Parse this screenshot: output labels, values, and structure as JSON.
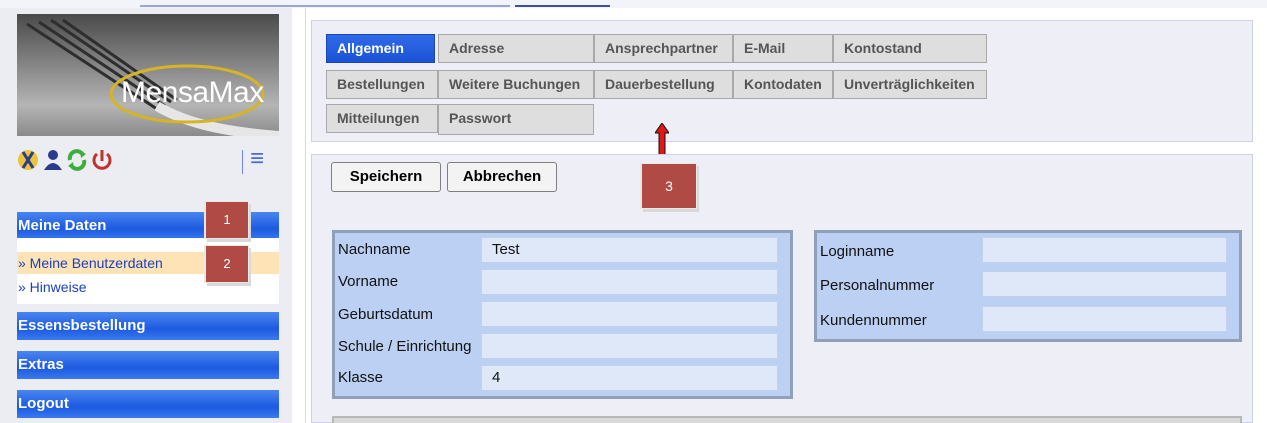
{
  "app": {
    "logo_text": "MensaMax"
  },
  "toolbar": {
    "icons": [
      "cutlery-icon",
      "user-icon",
      "refresh-icon",
      "power-icon",
      "menu-icon"
    ]
  },
  "sidebar": {
    "sections": [
      {
        "label": "Meine Daten"
      },
      {
        "label": "Essensbestellung"
      },
      {
        "label": "Extras"
      },
      {
        "label": "Logout"
      }
    ],
    "subitems": [
      {
        "label": "» Meine Benutzerdaten",
        "active": true
      },
      {
        "label": "» Hinweise",
        "active": false
      }
    ]
  },
  "annotations": {
    "m1": "1",
    "m2": "2",
    "m3": "3"
  },
  "tabs": {
    "row1": [
      "Allgemein",
      "Adresse",
      "Ansprechpartner",
      "E-Mail",
      "Kontostand"
    ],
    "row2": [
      "Bestellungen",
      "Weitere Buchungen",
      "Dauerbestellung",
      "Kontodaten",
      "Unverträglichkeiten"
    ],
    "row3": [
      "Mitteilungen",
      "Passwort"
    ],
    "active": "Allgemein"
  },
  "actions": {
    "save_label": "Speichern",
    "cancel_label": "Abbrechen"
  },
  "form_left": {
    "fields": [
      {
        "label": "Nachname",
        "value": "Test"
      },
      {
        "label": "Vorname",
        "value": ""
      },
      {
        "label": "Geburtsdatum",
        "value": ""
      },
      {
        "label": "Schule / Einrichtung",
        "value": ""
      },
      {
        "label": "Klasse",
        "value": "4"
      }
    ]
  },
  "form_right": {
    "fields": [
      {
        "label": "Loginname",
        "value": ""
      },
      {
        "label": "Personalnummer",
        "value": ""
      },
      {
        "label": "Kundennummer",
        "value": ""
      }
    ]
  },
  "colors": {
    "accent_blue": "#1c5ae0",
    "active_subitem": "#fde3b5",
    "marker_red": "#b04a45",
    "field_box": "#bcd0f3"
  }
}
